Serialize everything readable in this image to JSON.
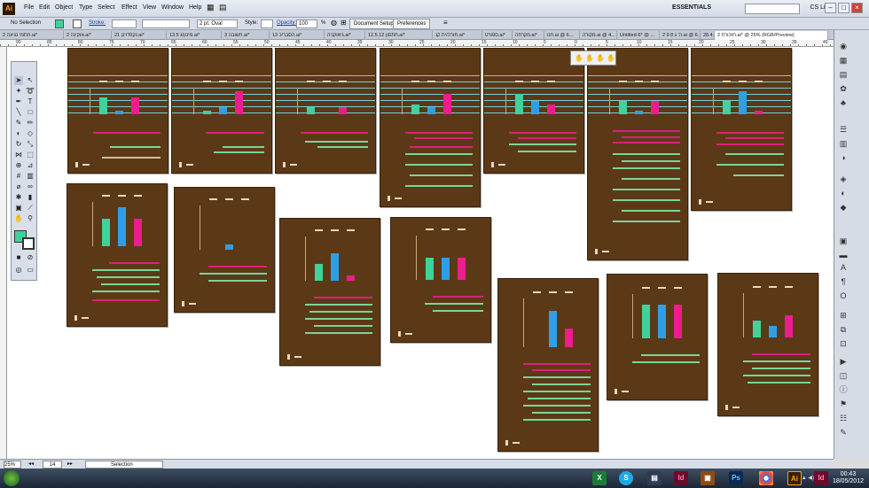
{
  "menubar": {
    "logo": "Ai",
    "items": [
      "File",
      "Edit",
      "Object",
      "Type",
      "Select",
      "Effect",
      "View",
      "Window",
      "Help"
    ],
    "workspace": "ESSENTIALS",
    "cs_live": "CS Live"
  },
  "control": {
    "selection": "No Selection",
    "stroke_label": "Stroke:",
    "brush": "2 pt. Oval",
    "style_label": "Style:",
    "opacity_label": "Opacity:",
    "opacity_value": "100",
    "percent": "%",
    "document_setup": "Document Setup",
    "preferences": "Preferences"
  },
  "tabs": [
    "חתמי נגיעה 2.ai*",
    "אוקינה 2.ai*",
    "נקפדוינן 21.ai*",
    "13.5 מינון/ג.ai*",
    "חשובה 3.ai*",
    "הסבר/כ 13.ai*",
    "גיאוקניה.ai*",
    "12.5.12 חתסון.ai*",
    "חזרה/ית קנ.ai*",
    "ספורט.ai*",
    "מקרחה.ai*",
    "חנו.ai @ 6...",
    "מקורה.ai @ 4...",
    "Untitled-6* @ ...",
    "2 9 8 ה' ג.ai @ 6...",
    "28.4.ai @ 25%",
    "תזכורת 2.ai* @ 25% (RGB/Preview)"
  ],
  "ruler": {
    "marks": [
      "90",
      "85",
      "80",
      "75",
      "70",
      "65",
      "60",
      "55",
      "50",
      "45",
      "40",
      "35",
      "30",
      "25",
      "20",
      "15",
      "10",
      "5",
      "0",
      "5",
      "10",
      "15",
      "20",
      "25",
      "30",
      "35",
      "40"
    ]
  },
  "status": {
    "zoom": "25%",
    "page": "14",
    "tool": "Selection"
  },
  "taskbar": {
    "time": "00:43",
    "date": "18/05/2012",
    "lang": "HE"
  },
  "colors": {
    "green": "#3fd29c",
    "blue": "#2e9fe6",
    "pink": "#ee1c8c",
    "board": "#5c3916"
  },
  "chart_data": [
    {
      "type": "bar",
      "series": [
        {
          "name": "",
          "values": [
            5,
            1,
            5
          ]
        }
      ]
    },
    {
      "type": "bar",
      "series": [
        {
          "name": "",
          "values": [
            1,
            2,
            7
          ]
        }
      ]
    },
    {
      "type": "bar",
      "series": [
        {
          "name": "",
          "values": [
            2,
            0,
            2
          ]
        }
      ]
    },
    {
      "type": "bar",
      "series": [
        {
          "name": "",
          "values": [
            3,
            2,
            6
          ]
        }
      ]
    },
    {
      "type": "bar",
      "series": [
        {
          "name": "",
          "values": [
            6,
            4,
            3
          ]
        }
      ]
    },
    {
      "type": "bar",
      "series": [
        {
          "name": "",
          "values": [
            4,
            1,
            4
          ]
        }
      ]
    },
    {
      "type": "bar",
      "series": [
        {
          "name": "",
          "values": [
            4,
            7,
            1
          ]
        }
      ]
    },
    {
      "type": "bar",
      "series": [
        {
          "name": "",
          "values": [
            5,
            7,
            5
          ]
        }
      ]
    },
    {
      "type": "bar",
      "series": [
        {
          "name": "",
          "values": [
            0,
            1,
            0
          ]
        }
      ]
    },
    {
      "type": "bar",
      "series": [
        {
          "name": "",
          "values": [
            3,
            5,
            1
          ]
        }
      ]
    },
    {
      "type": "bar",
      "series": [
        {
          "name": "",
          "values": [
            4,
            4,
            4
          ]
        }
      ]
    },
    {
      "type": "bar",
      "series": [
        {
          "name": "",
          "values": [
            0,
            6,
            3
          ]
        }
      ]
    },
    {
      "type": "bar",
      "series": [
        {
          "name": "",
          "values": [
            6,
            6,
            6
          ]
        }
      ]
    },
    {
      "type": "bar",
      "series": [
        {
          "name": "",
          "values": [
            3,
            2,
            4
          ]
        }
      ]
    }
  ]
}
